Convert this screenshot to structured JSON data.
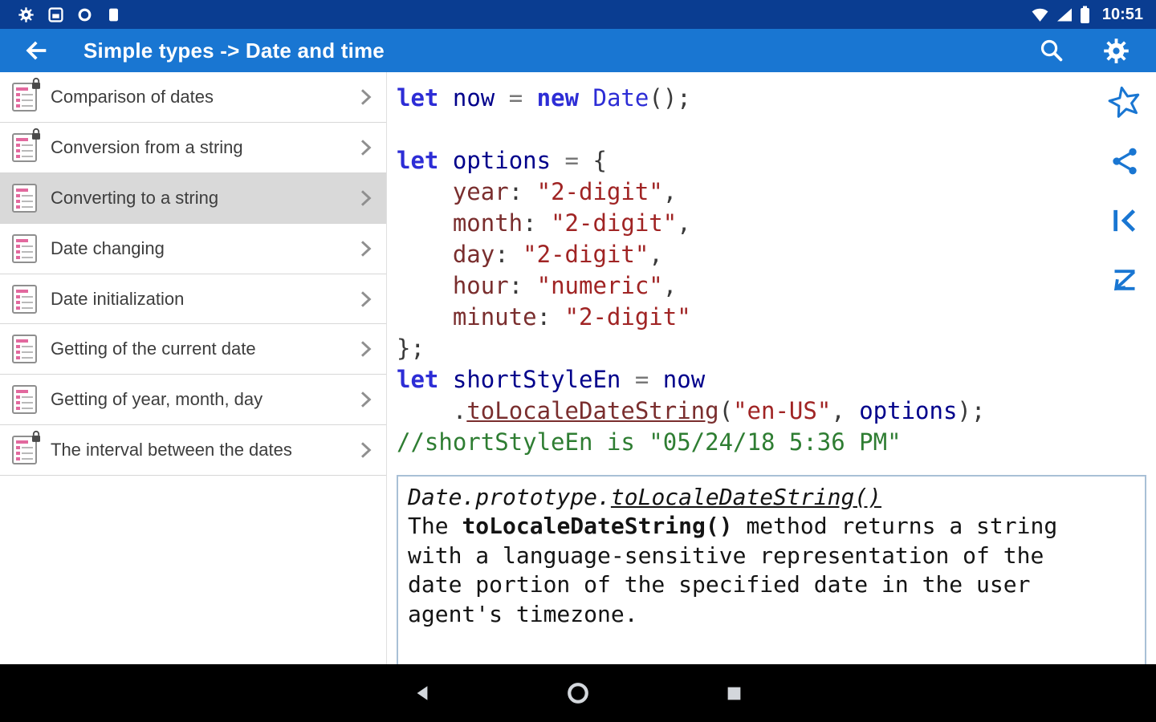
{
  "status_bar": {
    "time": "10:51",
    "left_icons": [
      "gear-icon",
      "screenshot-icon",
      "screen-record-icon",
      "storage-icon"
    ],
    "right_icons": [
      "wifi-icon",
      "cell-signal-icon",
      "battery-icon"
    ]
  },
  "app_bar": {
    "title": "Simple types -> Date and time",
    "icons": [
      "back-arrow-icon",
      "search-icon",
      "gear-icon"
    ]
  },
  "sidebar": {
    "items": [
      {
        "label": "Comparison of dates",
        "locked": true,
        "selected": false
      },
      {
        "label": "Conversion from a string",
        "locked": true,
        "selected": false
      },
      {
        "label": "Converting to a string",
        "locked": false,
        "selected": true
      },
      {
        "label": "Date changing",
        "locked": false,
        "selected": false
      },
      {
        "label": "Date initialization",
        "locked": false,
        "selected": false
      },
      {
        "label": "Getting of the current date",
        "locked": false,
        "selected": false
      },
      {
        "label": "Getting of year, month, day",
        "locked": false,
        "selected": false
      },
      {
        "label": "The interval between the dates",
        "locked": true,
        "selected": false
      }
    ]
  },
  "code": {
    "lines": [
      [
        {
          "t": "let",
          "c": "kw"
        },
        {
          "t": " ",
          "c": "pl"
        },
        {
          "t": "now",
          "c": "id"
        },
        {
          "t": " ",
          "c": "pl"
        },
        {
          "t": "=",
          "c": "op"
        },
        {
          "t": " ",
          "c": "pl"
        },
        {
          "t": "new",
          "c": "kw"
        },
        {
          "t": " ",
          "c": "pl"
        },
        {
          "t": "Date",
          "c": "cls"
        },
        {
          "t": "();",
          "c": "pl"
        }
      ],
      [],
      [
        {
          "t": "let",
          "c": "kw"
        },
        {
          "t": " ",
          "c": "pl"
        },
        {
          "t": "options",
          "c": "id"
        },
        {
          "t": " ",
          "c": "pl"
        },
        {
          "t": "=",
          "c": "op"
        },
        {
          "t": " {",
          "c": "pl"
        }
      ],
      [
        {
          "t": "    ",
          "c": "pl"
        },
        {
          "t": "year",
          "c": "prop"
        },
        {
          "t": ": ",
          "c": "pl"
        },
        {
          "t": "\"2-digit\"",
          "c": "str"
        },
        {
          "t": ",",
          "c": "pl"
        }
      ],
      [
        {
          "t": "    ",
          "c": "pl"
        },
        {
          "t": "month",
          "c": "prop"
        },
        {
          "t": ": ",
          "c": "pl"
        },
        {
          "t": "\"2-digit\"",
          "c": "str"
        },
        {
          "t": ",",
          "c": "pl"
        }
      ],
      [
        {
          "t": "    ",
          "c": "pl"
        },
        {
          "t": "day",
          "c": "prop"
        },
        {
          "t": ": ",
          "c": "pl"
        },
        {
          "t": "\"2-digit\"",
          "c": "str"
        },
        {
          "t": ",",
          "c": "pl"
        }
      ],
      [
        {
          "t": "    ",
          "c": "pl"
        },
        {
          "t": "hour",
          "c": "prop"
        },
        {
          "t": ": ",
          "c": "pl"
        },
        {
          "t": "\"numeric\"",
          "c": "str"
        },
        {
          "t": ",",
          "c": "pl"
        }
      ],
      [
        {
          "t": "    ",
          "c": "pl"
        },
        {
          "t": "minute",
          "c": "prop"
        },
        {
          "t": ": ",
          "c": "pl"
        },
        {
          "t": "\"2-digit\"",
          "c": "str"
        }
      ],
      [
        {
          "t": "};",
          "c": "pl"
        }
      ],
      [
        {
          "t": "let",
          "c": "kw"
        },
        {
          "t": " ",
          "c": "pl"
        },
        {
          "t": "shortStyleEn",
          "c": "id"
        },
        {
          "t": " ",
          "c": "pl"
        },
        {
          "t": "=",
          "c": "op"
        },
        {
          "t": " ",
          "c": "pl"
        },
        {
          "t": "now",
          "c": "id"
        }
      ],
      [
        {
          "t": "    .",
          "c": "pl"
        },
        {
          "t": "toLocaleDateString",
          "c": "link"
        },
        {
          "t": "(",
          "c": "pl"
        },
        {
          "t": "\"en-US\"",
          "c": "str"
        },
        {
          "t": ", ",
          "c": "pl"
        },
        {
          "t": "options",
          "c": "id"
        },
        {
          "t": ");",
          "c": "pl"
        }
      ],
      [
        {
          "t": "//shortStyleEn is \"05/24/18 5:36 PM\"",
          "c": "cm"
        }
      ]
    ]
  },
  "info_box": {
    "title": [
      {
        "t": "Date.prototype.",
        "s": "it"
      },
      {
        "t": "toLocaleDateString()",
        "s": "it ul",
        "link": true
      }
    ],
    "lines": [
      [
        {
          "t": "The ",
          "s": ""
        },
        {
          "t": "toLocaleDateString()",
          "s": "b"
        },
        {
          "t": " method returns a string",
          "s": ""
        }
      ],
      [
        {
          "t": "with a language-sensitive representation of the",
          "s": ""
        }
      ],
      [
        {
          "t": "date portion of the specified date in the user",
          "s": ""
        }
      ],
      [
        {
          "t": "agent's timezone.",
          "s": ""
        }
      ]
    ]
  },
  "side_toolbar": {
    "icons": [
      "star-outline-icon",
      "share-icon",
      "skip-to-start-icon",
      "skip-to-end-icon"
    ]
  },
  "nav_bar": {
    "icons": [
      "back-triangle-icon",
      "home-circle-icon",
      "recents-square-icon"
    ]
  },
  "colors": {
    "status_bar_bg": "#0a3d91",
    "app_bar_bg": "#1976d2",
    "accent": "#1976d2",
    "selected_item_bg": "#d9d9d9",
    "keyword": "#2d2dd6",
    "identifier": "#00008b",
    "property": "#7a2e2e",
    "string": "#a02424",
    "comment": "#2e7d32",
    "link": "#7a2e2e",
    "info_border": "#a9c0d6"
  }
}
